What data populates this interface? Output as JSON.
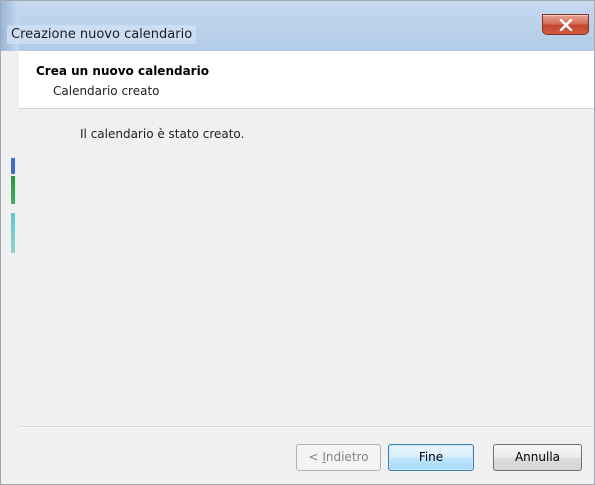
{
  "window": {
    "title": "Creazione nuovo calendario"
  },
  "header": {
    "title": "Crea un nuovo calendario",
    "subtitle": "Calendario creato"
  },
  "body": {
    "message": "Il calendario è stato creato."
  },
  "buttons": {
    "back_prefix": "< ",
    "back_mnemonic": "I",
    "back_rest": "ndietro",
    "finish_label": "Fine",
    "cancel_label": "Annulla"
  },
  "icons": {
    "close": "close-icon"
  },
  "colors": {
    "close_button": "#c4462f",
    "default_button_border": "#3c7fb1",
    "header_background": "#ffffff",
    "dialog_background": "#f0f0f0"
  }
}
